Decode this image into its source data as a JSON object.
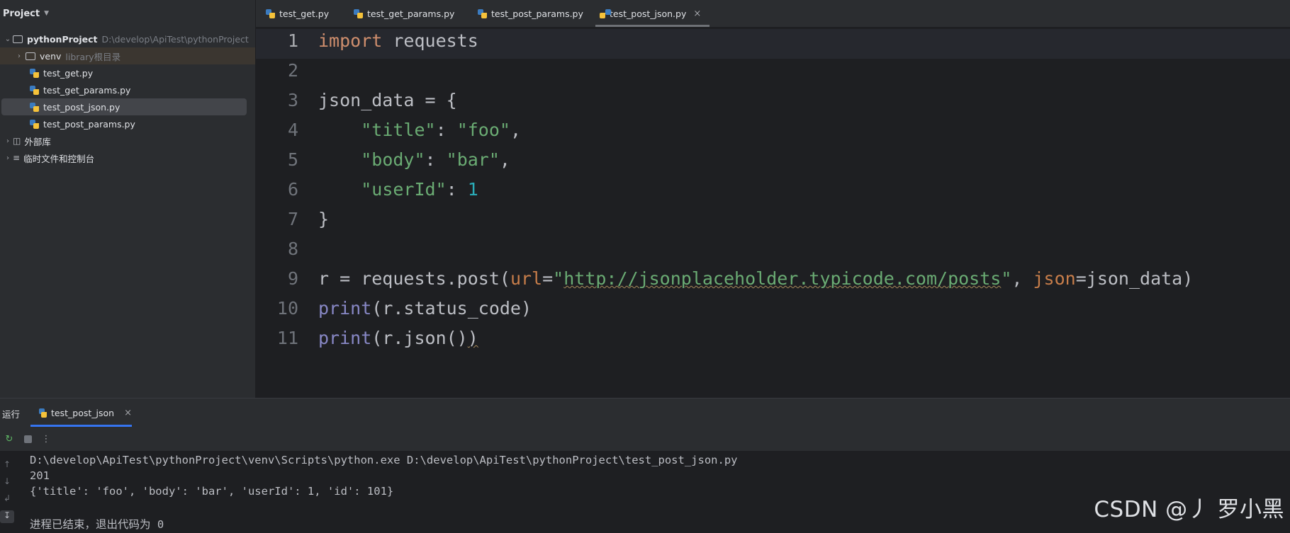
{
  "sidebar": {
    "title": "Project",
    "root": {
      "label": "pythonProject",
      "path": "D:\\develop\\ApiTest\\pythonProject"
    },
    "venv": {
      "label": "venv",
      "hint": "library根目录"
    },
    "files": [
      "test_get.py",
      "test_get_params.py",
      "test_post_json.py",
      "test_post_params.py"
    ],
    "selected_file": "test_post_json.py",
    "external_libs": "外部库",
    "scratches": "临时文件和控制台"
  },
  "tabs": [
    {
      "label": "test_get.py",
      "active": false
    },
    {
      "label": "test_get_params.py",
      "active": false
    },
    {
      "label": "test_post_params.py",
      "active": false
    },
    {
      "label": "test_post_json.py",
      "active": true
    }
  ],
  "editor": {
    "line_numbers": [
      "1",
      "2",
      "3",
      "4",
      "5",
      "6",
      "7",
      "8",
      "9",
      "10",
      "11"
    ],
    "current_line": 1,
    "code": {
      "l1_kw": "import",
      "l1_rest": " requests",
      "l3": "json_data = {",
      "l4_key": "\"title\"",
      "l4_sep": ": ",
      "l4_val": "\"foo\"",
      "l4_end": ",",
      "l5_key": "\"body\"",
      "l5_sep": ": ",
      "l5_val": "\"bar\"",
      "l5_end": ",",
      "l6_key": "\"userId\"",
      "l6_sep": ": ",
      "l6_val": "1",
      "l7": "}",
      "l9_a": "r = requests.post(",
      "l9_p1": "url",
      "l9_eq1": "=",
      "l9_q1": "\"",
      "l9_url": "http://jsonplaceholder.typicode.com/posts",
      "l9_q2": "\"",
      "l9_comma": ", ",
      "l9_p2": "json",
      "l9_b": "=json_data)",
      "l10_fn": "print",
      "l10_rest": "(r.status_code)",
      "l11_fn": "print",
      "l11_a": "(r.json()",
      "l11_b": ")"
    }
  },
  "run_panel": {
    "title": "运行",
    "tab_label": "test_post_json",
    "console": [
      "D:\\develop\\ApiTest\\pythonProject\\venv\\Scripts\\python.exe D:\\develop\\ApiTest\\pythonProject\\test_post_json.py",
      "201",
      "{'title': 'foo', 'body': 'bar', 'userId': 1, 'id': 101}",
      "",
      "进程已结束，退出代码为 0"
    ]
  },
  "watermark": "CSDN @丿 罗小黑",
  "colors": {
    "keyword": "#cf8e6d",
    "string": "#6aab73",
    "number": "#2aacb8",
    "builtin": "#8888c6",
    "param": "#c77d4a",
    "accent": "#3574f0"
  }
}
